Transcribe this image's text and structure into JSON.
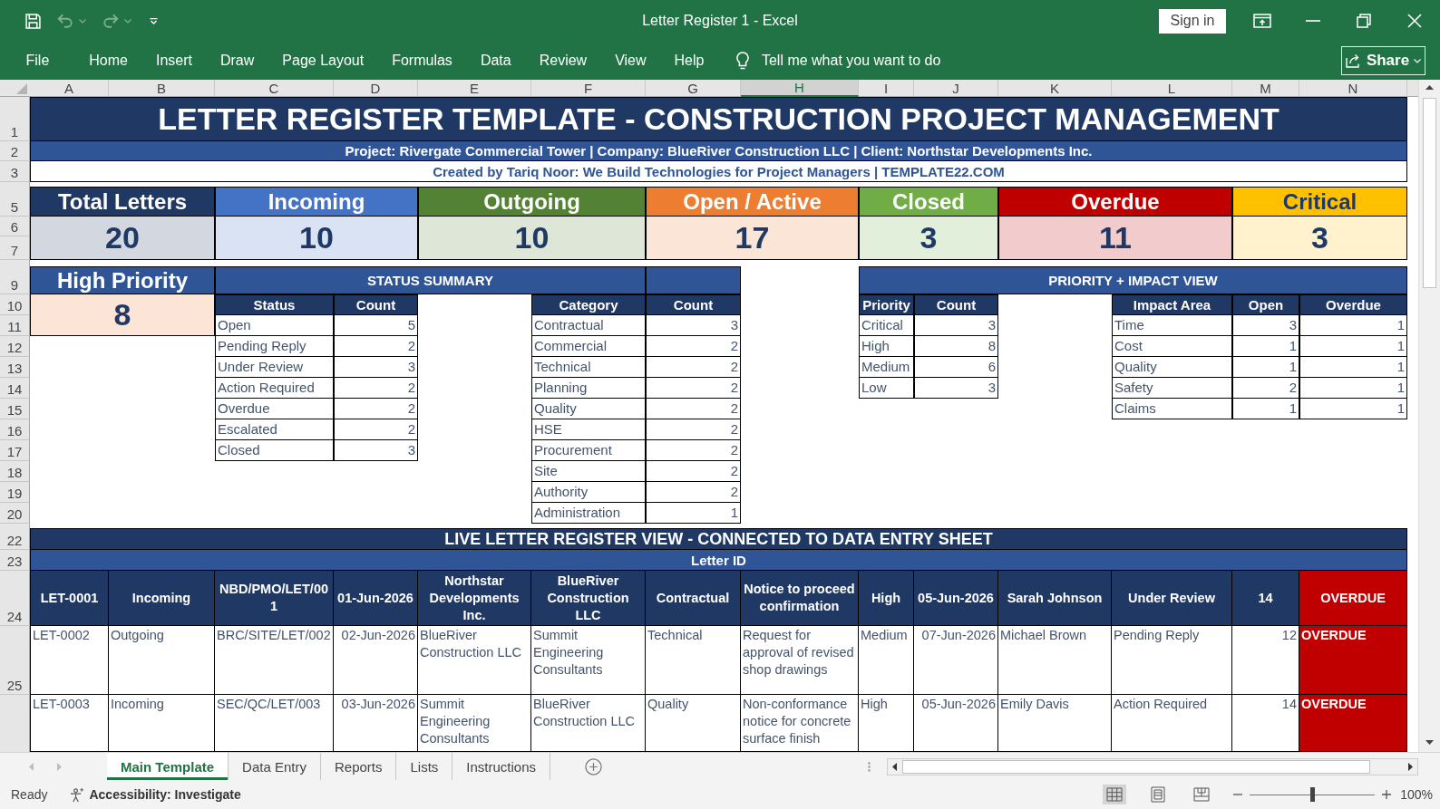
{
  "window": {
    "title": "Letter Register 1 - Excel",
    "sign_in": "Sign in"
  },
  "quick_access": [
    {
      "kind": "save",
      "disabled": false
    },
    {
      "kind": "undo",
      "disabled": true
    },
    {
      "kind": "redo",
      "disabled": true
    },
    {
      "kind": "customize",
      "disabled": false
    }
  ],
  "ribbon": {
    "tabs": [
      {
        "label": "File",
        "selected": false
      },
      {
        "label": "Home",
        "selected": false
      },
      {
        "label": "Insert",
        "selected": false
      },
      {
        "label": "Draw",
        "selected": false
      },
      {
        "label": "Page Layout",
        "selected": false
      },
      {
        "label": "Formulas",
        "selected": false
      },
      {
        "label": "Data",
        "selected": false
      },
      {
        "label": "Review",
        "selected": false
      },
      {
        "label": "View",
        "selected": false
      },
      {
        "label": "Help",
        "selected": false
      }
    ],
    "tell_me": "Tell me what you want to do",
    "share": "Share"
  },
  "column_headers": [
    {
      "label": "A",
      "selected": false
    },
    {
      "label": "B",
      "selected": false
    },
    {
      "label": "C",
      "selected": false
    },
    {
      "label": "D",
      "selected": false
    },
    {
      "label": "E",
      "selected": false
    },
    {
      "label": "F",
      "selected": false
    },
    {
      "label": "G",
      "selected": false
    },
    {
      "label": "H",
      "selected": true
    },
    {
      "label": "I",
      "selected": false
    },
    {
      "label": "J",
      "selected": false
    },
    {
      "label": "K",
      "selected": false
    },
    {
      "label": "L",
      "selected": false
    },
    {
      "label": "M",
      "selected": false
    },
    {
      "label": "N",
      "selected": false
    }
  ],
  "row_headers": [
    {
      "label": "1",
      "selected": false
    },
    {
      "label": "2",
      "selected": false
    },
    {
      "label": "3",
      "selected": false
    },
    {
      "label": "5",
      "selected": false
    },
    {
      "label": "6",
      "selected": false
    },
    {
      "label": "7",
      "selected": false
    },
    {
      "label": "9",
      "selected": false
    },
    {
      "label": "10",
      "selected": false
    },
    {
      "label": "11",
      "selected": false
    },
    {
      "label": "12",
      "selected": false
    },
    {
      "label": "13",
      "selected": false
    },
    {
      "label": "14",
      "selected": false
    },
    {
      "label": "15",
      "selected": false
    },
    {
      "label": "16",
      "selected": false
    },
    {
      "label": "17",
      "selected": false
    },
    {
      "label": "18",
      "selected": false
    },
    {
      "label": "19",
      "selected": false
    },
    {
      "label": "20",
      "selected": false
    },
    {
      "label": "22",
      "selected": false
    },
    {
      "label": "23",
      "selected": false
    },
    {
      "label": "24",
      "selected": false
    },
    {
      "label": "25",
      "selected": false
    }
  ],
  "banner": {
    "title": "LETTER REGISTER TEMPLATE - CONSTRUCTION PROJECT MANAGEMENT",
    "subtitle": "Project: Rivergate Commercial Tower | Company: BlueRiver Construction LLC | Client: Northstar Developments Inc.",
    "credit": "Created by Tariq Noor: We Build Technologies for Project Managers | TEMPLATE22.COM"
  },
  "kpis": [
    {
      "label": "Total Letters",
      "value": "20",
      "color": "#1f3864"
    },
    {
      "label": "Incoming",
      "value": "10",
      "color": "#4472c4"
    },
    {
      "label": "Outgoing",
      "value": "10",
      "color": "#548235"
    },
    {
      "label": "Open / Active",
      "value": "17",
      "color": "#ed7d31"
    },
    {
      "label": "Closed",
      "value": "3",
      "color": "#70ad47"
    },
    {
      "label": "Overdue",
      "value": "11",
      "color": "#c00000"
    },
    {
      "label": "Critical",
      "value": "3",
      "color": "#ffc000"
    }
  ],
  "high_priority": {
    "label": "High Priority",
    "value": "8"
  },
  "status_summary": {
    "title": "STATUS SUMMARY",
    "status_table": {
      "columns": [
        "Status",
        "Count"
      ],
      "rows": [
        [
          "Open",
          "5"
        ],
        [
          "Pending Reply",
          "2"
        ],
        [
          "Under Review",
          "3"
        ],
        [
          "Action Required",
          "2"
        ],
        [
          "Overdue",
          "2"
        ],
        [
          "Escalated",
          "2"
        ],
        [
          "Closed",
          "3"
        ]
      ]
    },
    "category_table": {
      "columns": [
        "Category",
        "Count"
      ],
      "rows": [
        [
          "Contractual",
          "3"
        ],
        [
          "Commercial",
          "2"
        ],
        [
          "Technical",
          "2"
        ],
        [
          "Planning",
          "2"
        ],
        [
          "Quality",
          "2"
        ],
        [
          "HSE",
          "2"
        ],
        [
          "Procurement",
          "2"
        ],
        [
          "Site",
          "2"
        ],
        [
          "Authority",
          "2"
        ],
        [
          "Administration",
          "1"
        ]
      ]
    }
  },
  "priority_impact": {
    "title": "PRIORITY + IMPACT VIEW",
    "priority_table": {
      "columns": [
        "Priority",
        "Count"
      ],
      "rows": [
        [
          "Critical",
          "3"
        ],
        [
          "High",
          "8"
        ],
        [
          "Medium",
          "6"
        ],
        [
          "Low",
          "3"
        ]
      ]
    },
    "impact_table": {
      "columns": [
        "Impact Area",
        "Open",
        "Overdue"
      ],
      "rows": [
        [
          "Time",
          "3",
          "1"
        ],
        [
          "Cost",
          "1",
          "1"
        ],
        [
          "Quality",
          "1",
          "1"
        ],
        [
          "Safety",
          "2",
          "1"
        ],
        [
          "Claims",
          "1",
          "1"
        ]
      ]
    }
  },
  "register": {
    "title": "LIVE LETTER REGISTER VIEW - CONNECTED TO DATA ENTRY SHEET",
    "group_header": "Letter ID",
    "rows": [
      {
        "kind": "emphasis",
        "cells": [
          "LET-0001",
          "Incoming",
          "NBD/PMO/LET/001",
          "01-Jun-2026",
          "Northstar Developments Inc.",
          "BlueRiver Construction LLC",
          "Contractual",
          "Notice to proceed confirmation",
          "High",
          "05-Jun-2026",
          "Sarah Johnson",
          "Under Review",
          "14",
          "OVERDUE"
        ]
      },
      {
        "kind": "normal",
        "cells": [
          "LET-0002",
          "Outgoing",
          "BRC/SITE/LET/002",
          "02-Jun-2026",
          "BlueRiver Construction LLC",
          "Summit Engineering Consultants",
          "Technical",
          "Request for approval of revised shop drawings",
          "Medium",
          "07-Jun-2026",
          "Michael Brown",
          "Pending Reply",
          "12",
          "OVERDUE"
        ]
      },
      {
        "kind": "normal",
        "cells": [
          "LET-0003",
          "Incoming",
          "SEC/QC/LET/003",
          "03-Jun-2026",
          "Summit Engineering Consultants",
          "BlueRiver Construction LLC",
          "Quality",
          "Non-conformance notice for concrete surface finish",
          "High",
          "05-Jun-2026",
          "Emily Davis",
          "Action Required",
          "14",
          "OVERDUE"
        ]
      }
    ]
  },
  "sheet_tabs": [
    {
      "label": "Main Template",
      "selected": true
    },
    {
      "label": "Data Entry",
      "selected": false
    },
    {
      "label": "Reports",
      "selected": false
    },
    {
      "label": "Lists",
      "selected": false
    },
    {
      "label": "Instructions",
      "selected": false
    }
  ],
  "status_bar": {
    "mode": "Ready",
    "accessibility": "Accessibility: Investigate",
    "views": [
      {
        "kind": "normal",
        "selected": true
      },
      {
        "kind": "page-layout",
        "selected": false
      },
      {
        "kind": "page-break",
        "selected": false
      }
    ],
    "zoom": {
      "level": 0.5,
      "reading": "100%"
    }
  }
}
